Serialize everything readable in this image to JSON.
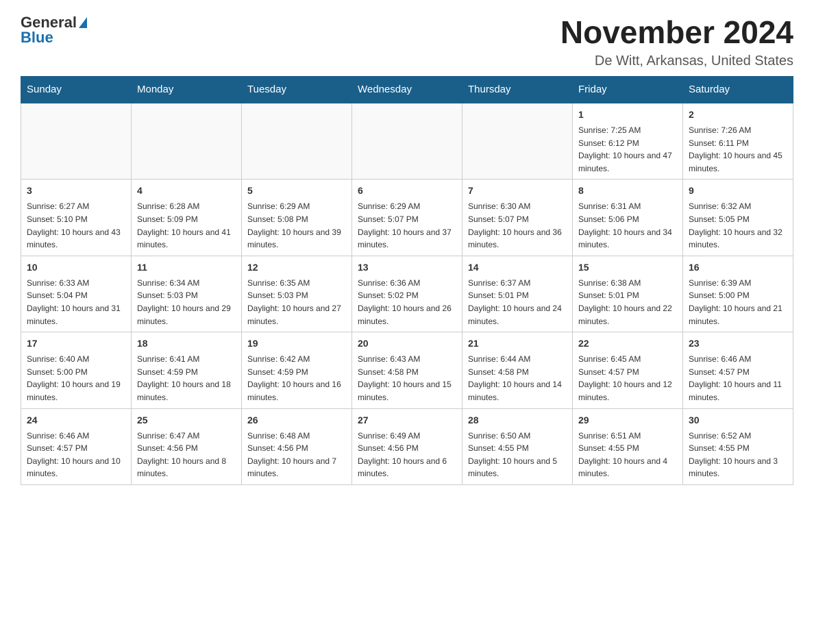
{
  "logo": {
    "text1": "General",
    "text2": "Blue"
  },
  "title": "November 2024",
  "location": "De Witt, Arkansas, United States",
  "days_of_week": [
    "Sunday",
    "Monday",
    "Tuesday",
    "Wednesday",
    "Thursday",
    "Friday",
    "Saturday"
  ],
  "weeks": [
    [
      {
        "day": "",
        "info": ""
      },
      {
        "day": "",
        "info": ""
      },
      {
        "day": "",
        "info": ""
      },
      {
        "day": "",
        "info": ""
      },
      {
        "day": "",
        "info": ""
      },
      {
        "day": "1",
        "info": "Sunrise: 7:25 AM\nSunset: 6:12 PM\nDaylight: 10 hours and 47 minutes."
      },
      {
        "day": "2",
        "info": "Sunrise: 7:26 AM\nSunset: 6:11 PM\nDaylight: 10 hours and 45 minutes."
      }
    ],
    [
      {
        "day": "3",
        "info": "Sunrise: 6:27 AM\nSunset: 5:10 PM\nDaylight: 10 hours and 43 minutes."
      },
      {
        "day": "4",
        "info": "Sunrise: 6:28 AM\nSunset: 5:09 PM\nDaylight: 10 hours and 41 minutes."
      },
      {
        "day": "5",
        "info": "Sunrise: 6:29 AM\nSunset: 5:08 PM\nDaylight: 10 hours and 39 minutes."
      },
      {
        "day": "6",
        "info": "Sunrise: 6:29 AM\nSunset: 5:07 PM\nDaylight: 10 hours and 37 minutes."
      },
      {
        "day": "7",
        "info": "Sunrise: 6:30 AM\nSunset: 5:07 PM\nDaylight: 10 hours and 36 minutes."
      },
      {
        "day": "8",
        "info": "Sunrise: 6:31 AM\nSunset: 5:06 PM\nDaylight: 10 hours and 34 minutes."
      },
      {
        "day": "9",
        "info": "Sunrise: 6:32 AM\nSunset: 5:05 PM\nDaylight: 10 hours and 32 minutes."
      }
    ],
    [
      {
        "day": "10",
        "info": "Sunrise: 6:33 AM\nSunset: 5:04 PM\nDaylight: 10 hours and 31 minutes."
      },
      {
        "day": "11",
        "info": "Sunrise: 6:34 AM\nSunset: 5:03 PM\nDaylight: 10 hours and 29 minutes."
      },
      {
        "day": "12",
        "info": "Sunrise: 6:35 AM\nSunset: 5:03 PM\nDaylight: 10 hours and 27 minutes."
      },
      {
        "day": "13",
        "info": "Sunrise: 6:36 AM\nSunset: 5:02 PM\nDaylight: 10 hours and 26 minutes."
      },
      {
        "day": "14",
        "info": "Sunrise: 6:37 AM\nSunset: 5:01 PM\nDaylight: 10 hours and 24 minutes."
      },
      {
        "day": "15",
        "info": "Sunrise: 6:38 AM\nSunset: 5:01 PM\nDaylight: 10 hours and 22 minutes."
      },
      {
        "day": "16",
        "info": "Sunrise: 6:39 AM\nSunset: 5:00 PM\nDaylight: 10 hours and 21 minutes."
      }
    ],
    [
      {
        "day": "17",
        "info": "Sunrise: 6:40 AM\nSunset: 5:00 PM\nDaylight: 10 hours and 19 minutes."
      },
      {
        "day": "18",
        "info": "Sunrise: 6:41 AM\nSunset: 4:59 PM\nDaylight: 10 hours and 18 minutes."
      },
      {
        "day": "19",
        "info": "Sunrise: 6:42 AM\nSunset: 4:59 PM\nDaylight: 10 hours and 16 minutes."
      },
      {
        "day": "20",
        "info": "Sunrise: 6:43 AM\nSunset: 4:58 PM\nDaylight: 10 hours and 15 minutes."
      },
      {
        "day": "21",
        "info": "Sunrise: 6:44 AM\nSunset: 4:58 PM\nDaylight: 10 hours and 14 minutes."
      },
      {
        "day": "22",
        "info": "Sunrise: 6:45 AM\nSunset: 4:57 PM\nDaylight: 10 hours and 12 minutes."
      },
      {
        "day": "23",
        "info": "Sunrise: 6:46 AM\nSunset: 4:57 PM\nDaylight: 10 hours and 11 minutes."
      }
    ],
    [
      {
        "day": "24",
        "info": "Sunrise: 6:46 AM\nSunset: 4:57 PM\nDaylight: 10 hours and 10 minutes."
      },
      {
        "day": "25",
        "info": "Sunrise: 6:47 AM\nSunset: 4:56 PM\nDaylight: 10 hours and 8 minutes."
      },
      {
        "day": "26",
        "info": "Sunrise: 6:48 AM\nSunset: 4:56 PM\nDaylight: 10 hours and 7 minutes."
      },
      {
        "day": "27",
        "info": "Sunrise: 6:49 AM\nSunset: 4:56 PM\nDaylight: 10 hours and 6 minutes."
      },
      {
        "day": "28",
        "info": "Sunrise: 6:50 AM\nSunset: 4:55 PM\nDaylight: 10 hours and 5 minutes."
      },
      {
        "day": "29",
        "info": "Sunrise: 6:51 AM\nSunset: 4:55 PM\nDaylight: 10 hours and 4 minutes."
      },
      {
        "day": "30",
        "info": "Sunrise: 6:52 AM\nSunset: 4:55 PM\nDaylight: 10 hours and 3 minutes."
      }
    ]
  ]
}
